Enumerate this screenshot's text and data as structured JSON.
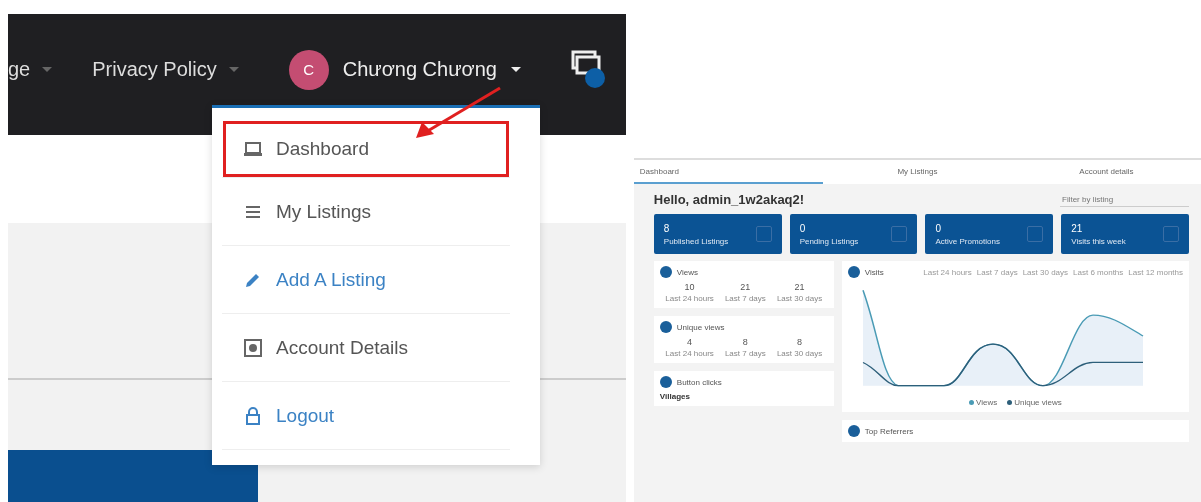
{
  "left_screenshot": {
    "nav_items": [
      {
        "label": "ge"
      },
      {
        "label": "Privacy Policy"
      }
    ],
    "user": {
      "initial": "C",
      "name": "Chương Chương"
    },
    "user_menu": [
      {
        "label": "Dashboard",
        "kind": "laptop",
        "color": "#555555",
        "highlighted": true
      },
      {
        "label": "My Listings",
        "kind": "list",
        "color": "#555555",
        "highlighted": false
      },
      {
        "label": "Add A Listing",
        "kind": "pencil",
        "color": "#3b82c4",
        "highlighted": false
      },
      {
        "label": "Account Details",
        "kind": "safe",
        "color": "#555555",
        "highlighted": false
      },
      {
        "label": "Logout",
        "kind": "lock",
        "color": "#3b82c4",
        "highlighted": false
      }
    ]
  },
  "right_screenshot": {
    "tabs": [
      {
        "label": "Dashboard",
        "selected": true
      },
      {
        "label": "My Listings",
        "selected": false
      },
      {
        "label": "Account details",
        "selected": false
      }
    ],
    "greeting": "Hello, admin_1w2akaq2!",
    "filter": {
      "placeholder": "Filter by listing"
    },
    "stat_cards": [
      {
        "value": "8",
        "label": "Published Listings"
      },
      {
        "value": "0",
        "label": "Pending Listings"
      },
      {
        "value": "0",
        "label": "Active Promotions"
      },
      {
        "value": "21",
        "label": "Visits this week"
      }
    ],
    "panels": [
      {
        "title": "Views",
        "stats": [
          {
            "value": "10",
            "label": "Last 24 hours"
          },
          {
            "value": "21",
            "label": "Last 7 days"
          },
          {
            "value": "21",
            "label": "Last 30 days"
          }
        ]
      },
      {
        "title": "Unique views",
        "stats": [
          {
            "value": "4",
            "label": "Last 24 hours"
          },
          {
            "value": "8",
            "label": "Last 7 days"
          },
          {
            "value": "8",
            "label": "Last 30 days"
          }
        ]
      }
    ],
    "button_clicks": {
      "title": "Button clicks",
      "heading": "Villages"
    },
    "visits": {
      "title": "Visits",
      "ranges": [
        "Last 24 hours",
        "Last 7 days",
        "Last 30 days",
        "Last 6 months",
        "Last 12 months"
      ],
      "legend": [
        {
          "label": "Views",
          "color": "#4a9bb5"
        },
        {
          "label": "Unique views",
          "color": "#2d5f7a"
        }
      ]
    },
    "top_referrers": {
      "title": "Top Referrers"
    }
  }
}
